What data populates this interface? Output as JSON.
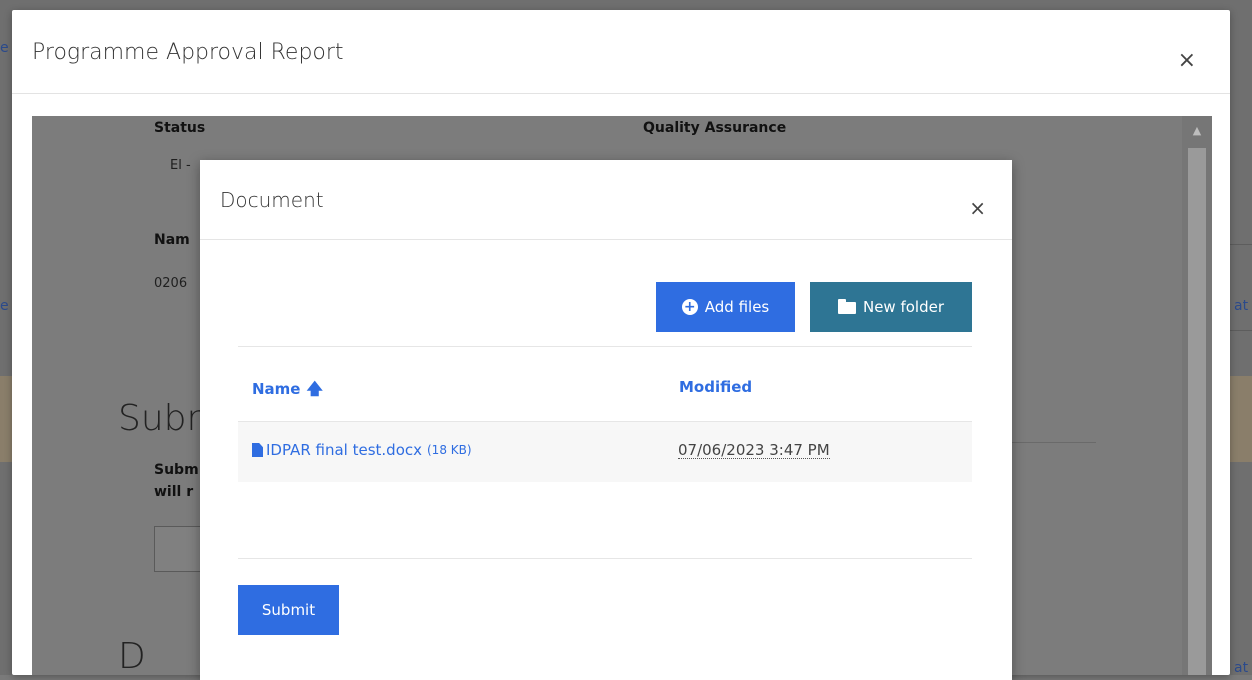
{
  "background_page": {
    "left_fragments": [
      "e",
      "e"
    ],
    "right_fragments": [
      "at",
      "at"
    ]
  },
  "outer_modal": {
    "title": "Programme Approval Report",
    "close": "×",
    "body": {
      "status_label": "Status",
      "status_value": "El -",
      "qa_label": "Quality Assurance",
      "name_label": "Nam",
      "name_value": "0206",
      "section_heading": "Subr",
      "section_text_line1": "Subm",
      "section_text_line2": "will r",
      "bottom_heading": "D"
    }
  },
  "document_modal": {
    "title": "Document",
    "close": "×",
    "add_files_label": "Add files",
    "new_folder_label": "New folder",
    "columns": {
      "name": "Name",
      "name_sort_icon": "arrow-up-icon",
      "modified": "Modified"
    },
    "files": [
      {
        "name": "IDPAR final test.docx",
        "size": "(18 KB)",
        "modified": "07/06/2023 3:47 PM"
      }
    ],
    "submit_label": "Submit"
  },
  "colors": {
    "primary": "#2f6de1",
    "folder_button": "#2e7594",
    "overlay": "#7c7c7c"
  }
}
